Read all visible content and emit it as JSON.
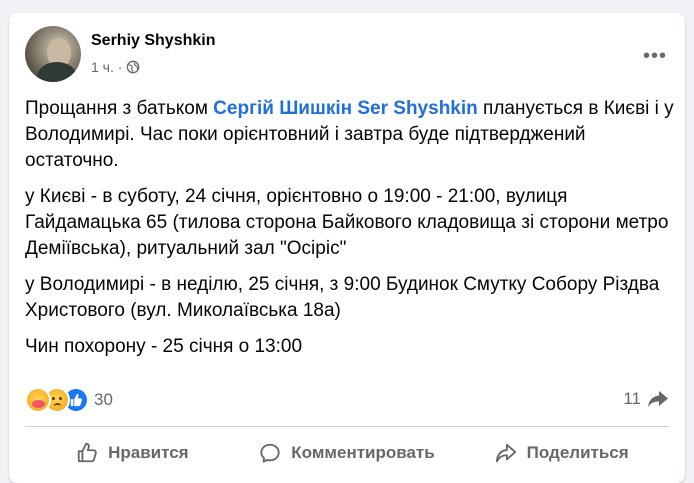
{
  "post": {
    "author": "Serhiy Shyshkin",
    "time": "1 ч. ·",
    "paragraphs": [
      {
        "before": "Прощання з батьком ",
        "mention": "Сергій Шишкін Ser Shyshkin",
        "after": " планується в Києві і у Володимирі. Час поки орієнтовний і завтра буде підтверджений остаточно."
      },
      {
        "text": "у Києві - в суботу, 24 січня, орієнтовно о 19:00 - 21:00, вулиця Гайдамацька 65 (тилова сторона Байкового кладовища зі сторони метро Деміївська), ритуальний зал \"Осіріс\""
      },
      {
        "text": "у Володимирі - в неділю, 25 січня, з 9:00 Будинок Смутку Собору Різдва Христового (вул. Миколаївська 18а)"
      },
      {
        "text": "Чин похорону  - 25 січня о 13:00"
      }
    ]
  },
  "reactions": {
    "icons": [
      "care-reaction-icon",
      "sad-reaction-icon",
      "like-reaction-icon"
    ],
    "count": "30",
    "shares": "11"
  },
  "actions": {
    "like_label": "Нравится",
    "comment_label": "Комментировать",
    "share_label": "Поделиться"
  },
  "colors": {
    "mention": "#216fdb",
    "secondary_text": "#65676b",
    "like_blue": "#1877f2",
    "background": "#f0f2f5"
  }
}
